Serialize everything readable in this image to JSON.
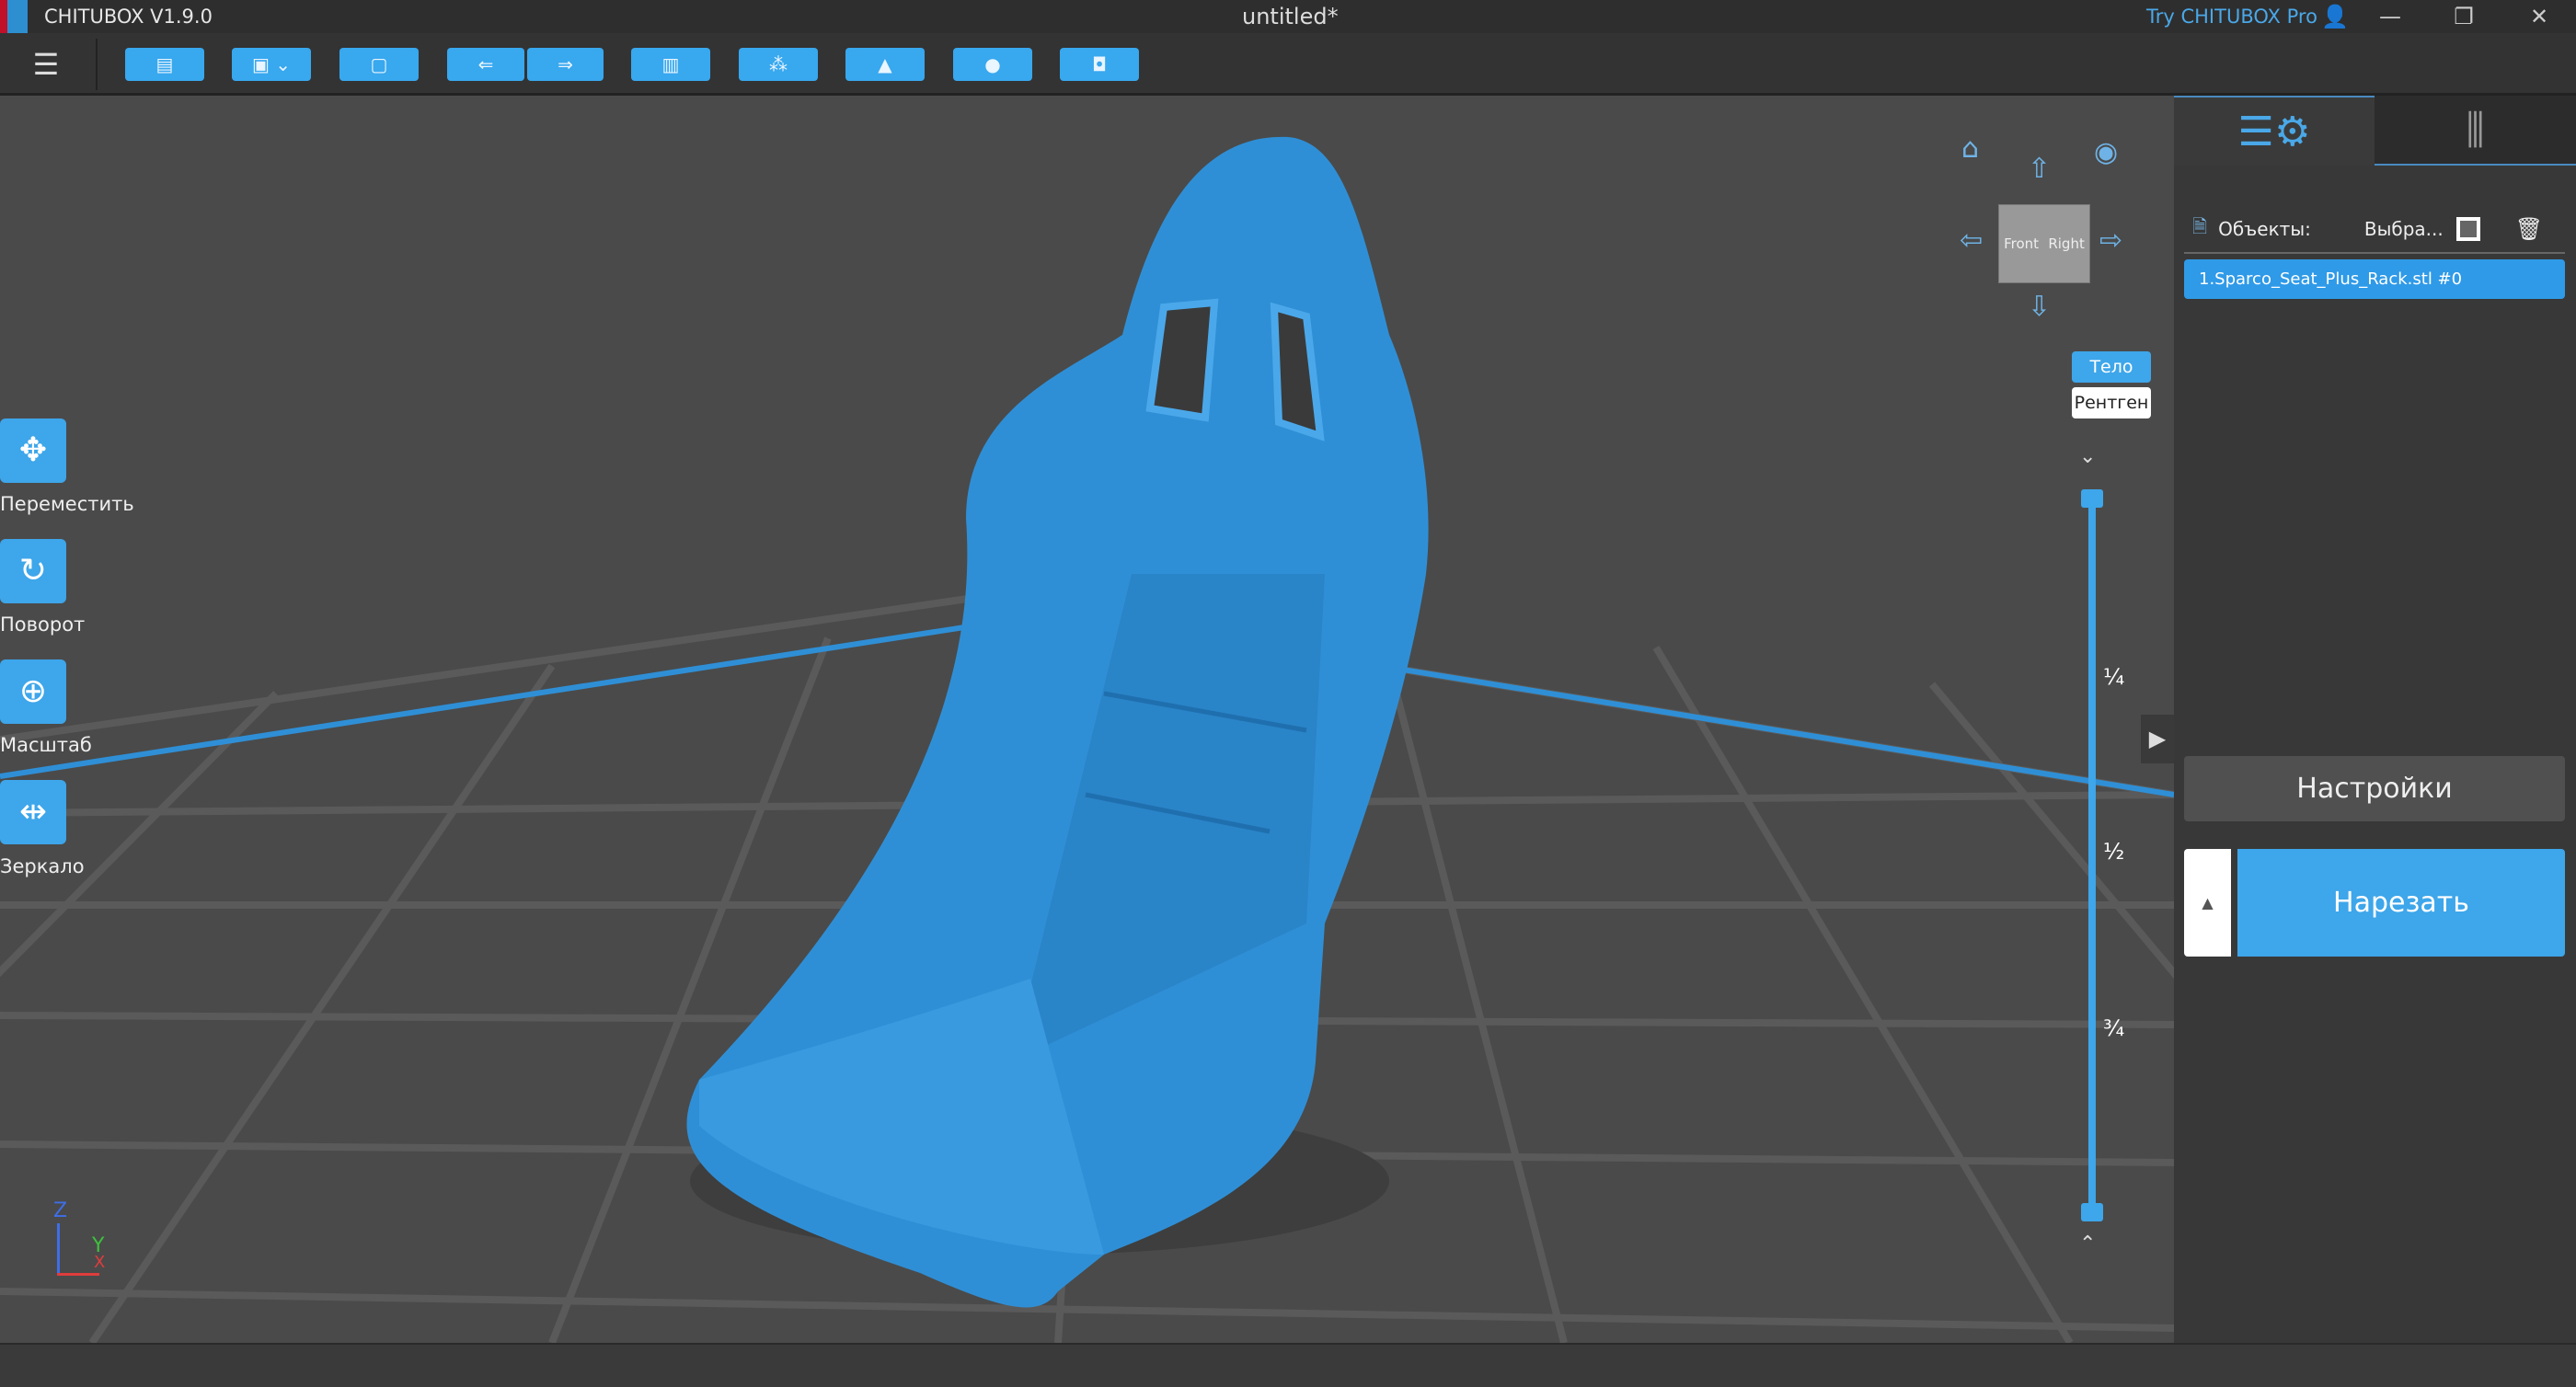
{
  "titlebar": {
    "app_name": "CHITUBOX V1.9.0",
    "doc_title": "untitled*",
    "try_pro": "Try CHITUBOX Pro"
  },
  "toolbar": {
    "buttons": [
      "open-file",
      "save",
      "import",
      "undo",
      "redo",
      "copy",
      "layout",
      "support",
      "hollow",
      "drain-hole"
    ]
  },
  "tools": [
    {
      "label": "Переместить",
      "icon": "move-icon"
    },
    {
      "label": "Поворот",
      "icon": "rotate-icon"
    },
    {
      "label": "Масштаб",
      "icon": "scale-icon"
    },
    {
      "label": "Зеркало",
      "icon": "mirror-icon"
    }
  ],
  "navcube": {
    "front": "Front",
    "right": "Right"
  },
  "view_modes": {
    "body": "Тело",
    "xray": "Рентген"
  },
  "slider": {
    "ticks": [
      "¼",
      "½",
      "¾"
    ]
  },
  "panel": {
    "objects_label": "Объекты:",
    "select_label": "Выбра...",
    "items": [
      "1.Sparco_Seat_Plus_Rack.stl #0"
    ],
    "settings": "Настройки",
    "slice": "Нарезать"
  },
  "axes": {
    "z": "Z",
    "y": "Y",
    "x": "X"
  },
  "colors": {
    "accent": "#3ea6ea",
    "model": "#2f8fd6"
  }
}
